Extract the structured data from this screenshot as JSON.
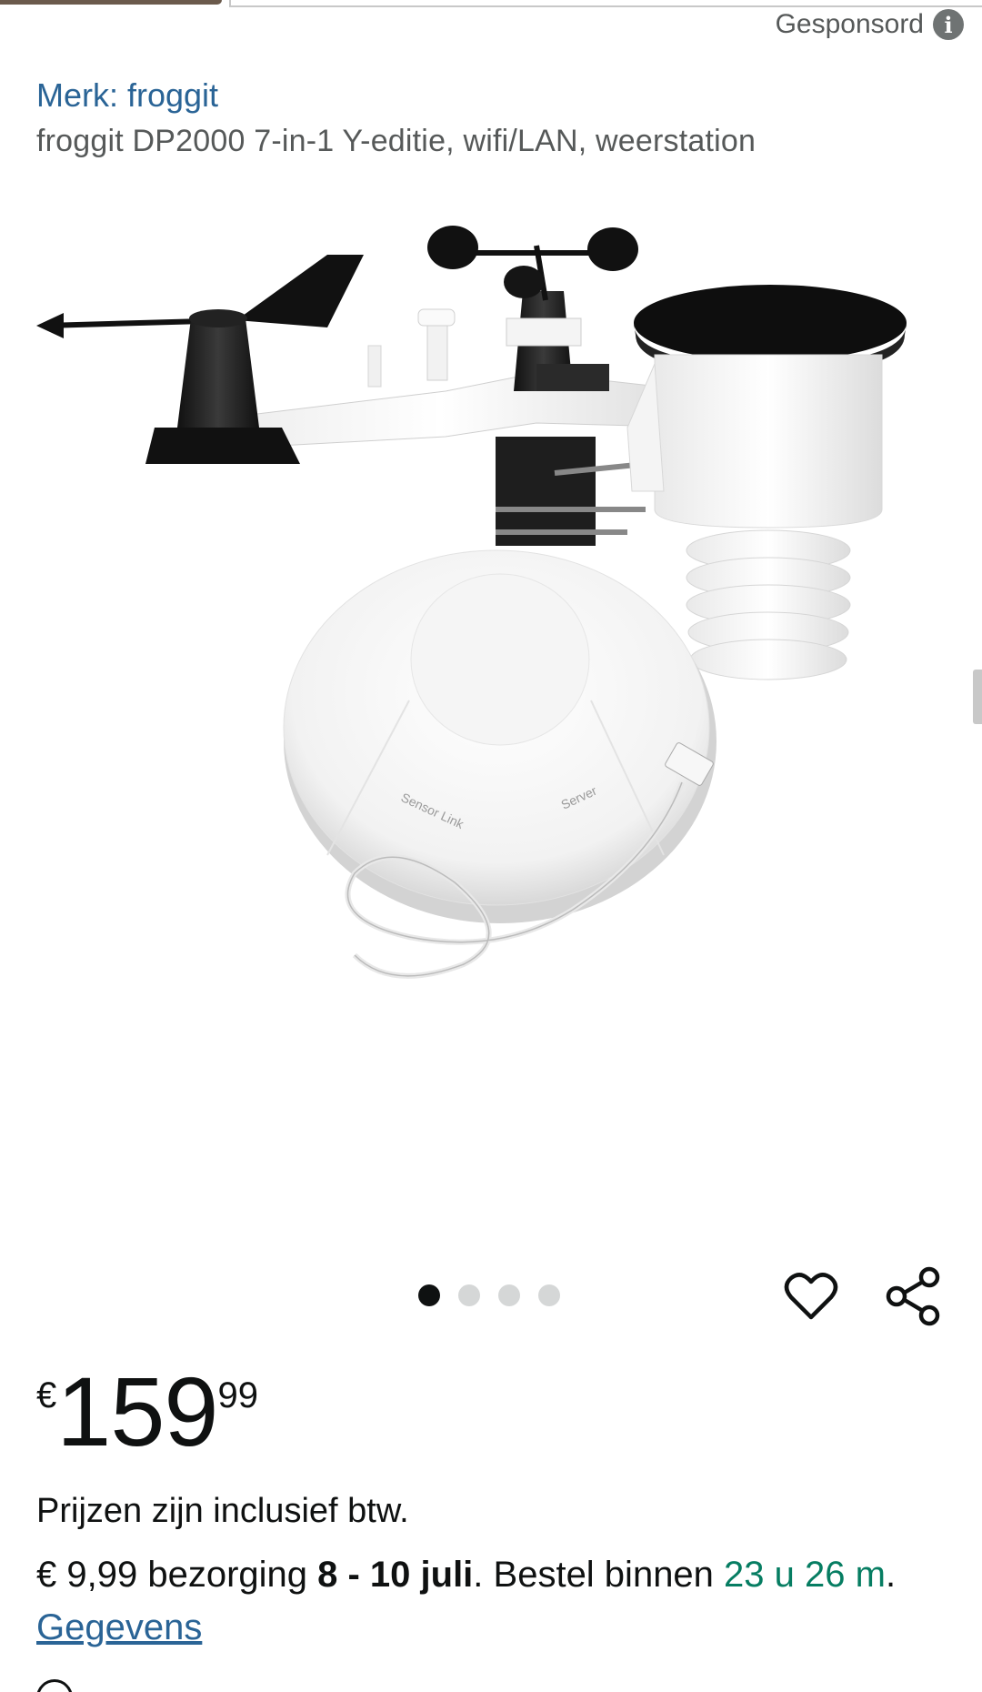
{
  "header": {
    "sponsored_label": "Gesponsord",
    "info_icon": "i"
  },
  "product": {
    "brand_link": "Merk: froggit",
    "title": "froggit DP2000 7-in-1 Y-editie, wifi/LAN, weerstation",
    "image_labels": {
      "sensor_link": "Sensor Link",
      "server": "Server"
    }
  },
  "carousel": {
    "total": 4,
    "active_index": 0
  },
  "actions": {
    "wishlist_icon": "heart-icon",
    "share_icon": "share-icon"
  },
  "price": {
    "symbol": "€",
    "whole": "159",
    "fraction": "99"
  },
  "tax_note": "Prijzen zijn inclusief btw.",
  "delivery": {
    "fee": "€ 9,99 bezorging ",
    "date": "8 - 10 juli",
    "order_prefix": ". Bestel binnen ",
    "countdown": "23 u 26 m",
    "after_countdown": ". ",
    "details_link": "Gegevens"
  },
  "colors": {
    "link": "#2a6496",
    "countdown": "#067d62",
    "text": "#0f1111",
    "muted": "#565959"
  }
}
